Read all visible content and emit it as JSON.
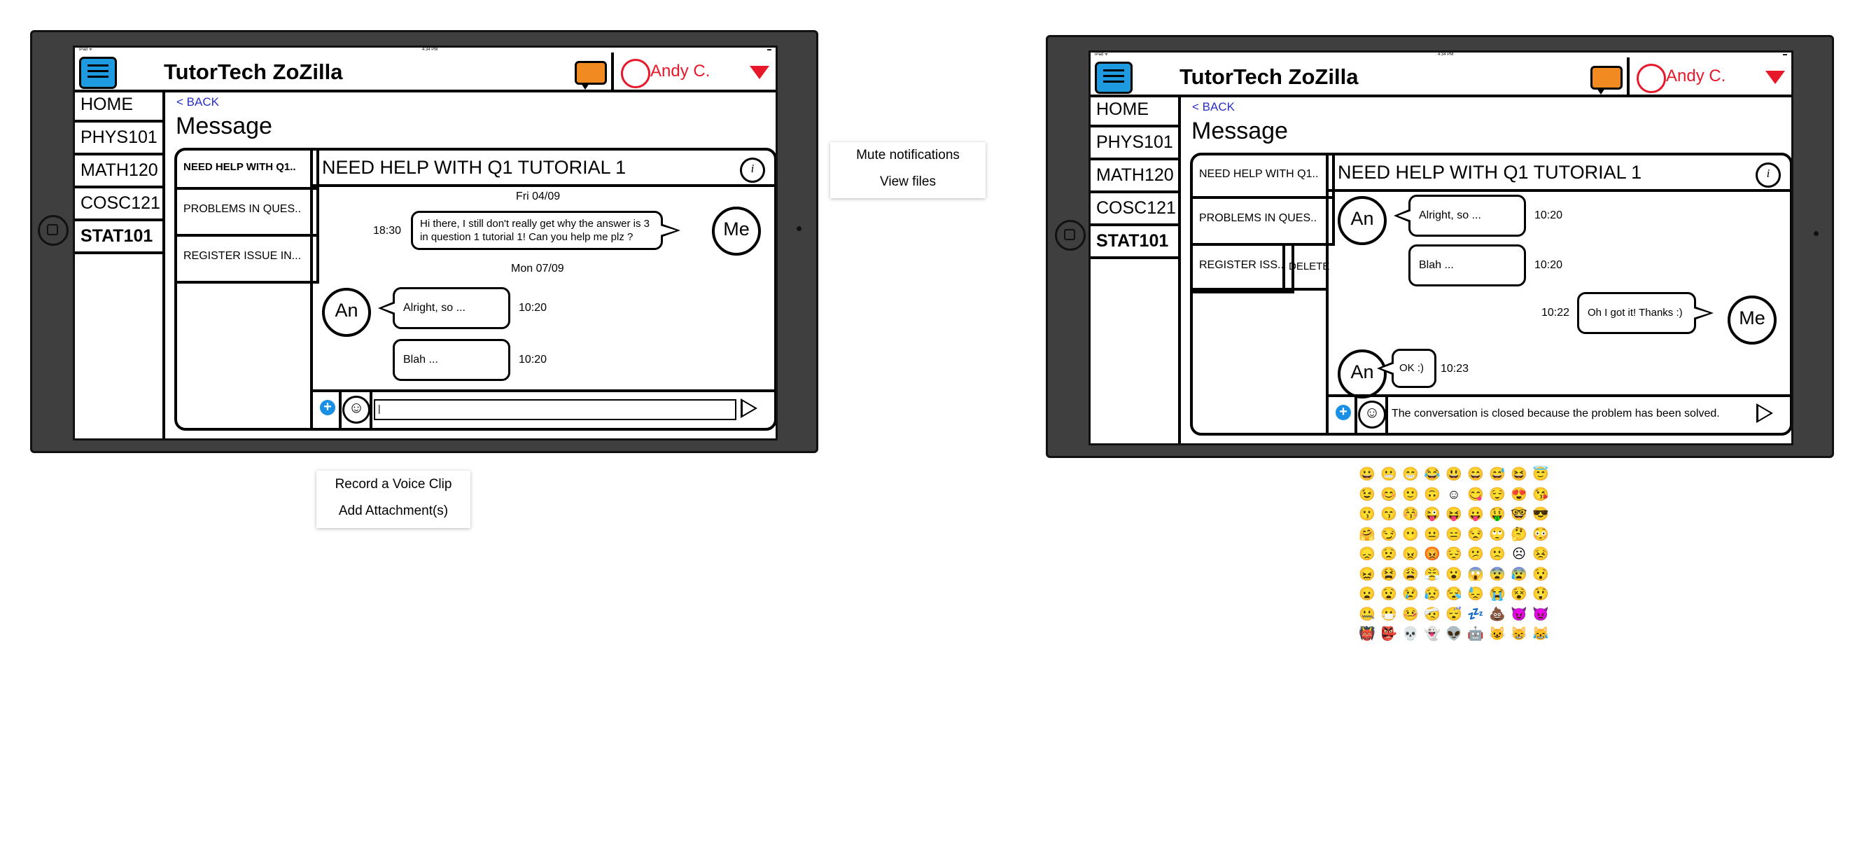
{
  "status_bar": {
    "left": "iPad ᯤ",
    "center": "4:34 PM",
    "right": "▬"
  },
  "app": {
    "title": "TutorTech ZoZilla",
    "user_name": "Andy C."
  },
  "sidebar": {
    "items": [
      {
        "label": "HOME",
        "bold": false
      },
      {
        "label": "PHYS101",
        "bold": false
      },
      {
        "label": "MATH120",
        "bold": false
      },
      {
        "label": "COSC121",
        "bold": false
      },
      {
        "label": "STAT101",
        "bold": true
      }
    ]
  },
  "page": {
    "back_label": "< BACK",
    "title": "Message"
  },
  "screen1": {
    "threads": [
      {
        "label": "NEED HELP WITH Q1.."
      },
      {
        "label": "PROBLEMS IN QUES.."
      },
      {
        "label": "REGISTER ISSUE IN..."
      }
    ],
    "conversation_title": "NEED HELP WITH Q1 TUTORIAL 1",
    "info_icon": "i",
    "date1": "Fri 04/09",
    "date2": "Mon 07/09",
    "messages": [
      {
        "sender": "Me",
        "time": "18:30",
        "text": "Hi there, I still don't really get why the answer is 3 in question 1 tutorial 1! Can you help me plz ?"
      },
      {
        "sender": "An",
        "time": "10:20",
        "text": "Alright, so ..."
      },
      {
        "sender": "An",
        "time": "10:20",
        "text": "Blah ..."
      }
    ],
    "input_value": "|"
  },
  "screen2": {
    "threads": [
      {
        "label": "NEED HELP WITH Q1.."
      },
      {
        "label": "PROBLEMS IN QUES.."
      },
      {
        "label": "REGISTER ISS.."
      }
    ],
    "delete_label": "DELETE",
    "conversation_title": "NEED HELP WITH Q1 TUTORIAL 1",
    "info_icon": "i",
    "messages": [
      {
        "sender": "An",
        "time": "10:20",
        "text": "Alright, so ..."
      },
      {
        "sender": "An",
        "time": "10:20",
        "text": "Blah ..."
      },
      {
        "sender": "Me",
        "time": "10:22",
        "text": "Oh I got it! Thanks :)"
      },
      {
        "sender": "An",
        "time": "10:23",
        "text": "OK :)"
      }
    ],
    "closed_notice": "The conversation is closed because the problem has been solved."
  },
  "options_menu": {
    "items": [
      "Mute notifications",
      "View files"
    ]
  },
  "attach_menu": {
    "items": [
      "Record a Voice Clip",
      "Add Attachment(s)"
    ]
  },
  "emoji_grid": [
    [
      "😀",
      "😬",
      "😁",
      "😂",
      "😃",
      "😄",
      "😅",
      "😆",
      "😇"
    ],
    [
      "😉",
      "😊",
      "🙂",
      "🙃",
      "☺",
      "😋",
      "😌",
      "😍",
      "😘"
    ],
    [
      "😗",
      "😙",
      "😚",
      "😜",
      "😝",
      "😛",
      "🤑",
      "🤓",
      "😎"
    ],
    [
      "🤗",
      "😏",
      "😶",
      "😐",
      "😑",
      "😒",
      "🙄",
      "🤔",
      "😳"
    ],
    [
      "😞",
      "😟",
      "😠",
      "😡",
      "😔",
      "😕",
      "🙁",
      "☹",
      "😣"
    ],
    [
      "😖",
      "😫",
      "😩",
      "😤",
      "😮",
      "😱",
      "😨",
      "😰",
      "😯"
    ],
    [
      "😦",
      "😧",
      "😢",
      "😥",
      "😪",
      "😓",
      "😭",
      "😵",
      "😲"
    ],
    [
      "🤐",
      "😷",
      "🤒",
      "🤕",
      "😴",
      "💤",
      "💩",
      "😈",
      "👿"
    ],
    [
      "👹",
      "👺",
      "💀",
      "👻",
      "👽",
      "🤖",
      "😺",
      "😸",
      "😹"
    ]
  ],
  "colors": {
    "brand_orange": "#f28a22",
    "menu_blue": "#1e9be0",
    "user_red": "#e8182b",
    "link_blue": "#2a2fc9",
    "tablet_gray": "#3f3f3f"
  }
}
